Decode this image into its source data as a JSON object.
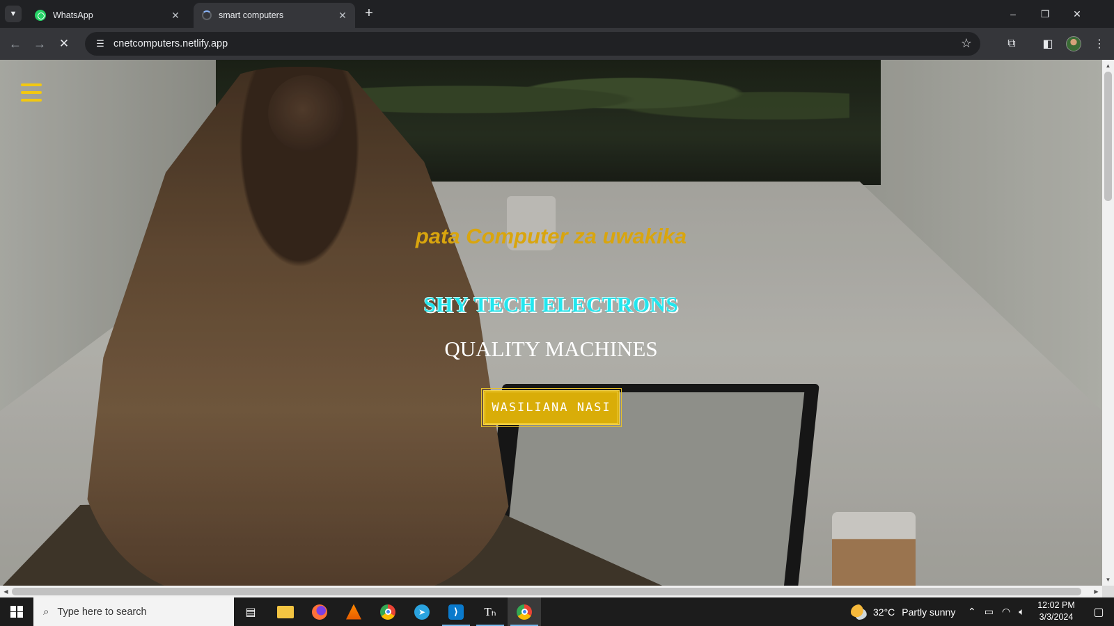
{
  "browser": {
    "tab_list_icon": "chevron-down-icon",
    "tabs": [
      {
        "title": "WhatsApp",
        "icon": "whatsapp-icon",
        "active": false
      },
      {
        "title": "smart computers",
        "icon": "loading-spinner-icon",
        "active": true
      }
    ],
    "new_tab_icon": "plus-icon",
    "window_controls": {
      "minimize": "–",
      "restore": "❐",
      "close": "✕"
    },
    "address_bar": {
      "url": "cnetcomputers.netlify.app"
    }
  },
  "page": {
    "menu_icon": "hamburger-menu-icon",
    "menu_color": "#f2c811",
    "tagline": "pata Computer za uwakika",
    "brand": "SHY TECH ELECTRONS",
    "subtitle": "QUALITY MACHINES",
    "cta_label": "WASILIANA NASI",
    "accent_color": "#d9ad08",
    "brand_color": "#22e6ee"
  },
  "taskbar": {
    "search_placeholder": "Type here to search",
    "apps": [
      {
        "name": "task-view"
      },
      {
        "name": "file-explorer"
      },
      {
        "name": "firefox"
      },
      {
        "name": "vlc"
      },
      {
        "name": "chrome"
      },
      {
        "name": "telegram"
      },
      {
        "name": "vscode"
      },
      {
        "name": "typora"
      },
      {
        "name": "chrome-active"
      }
    ],
    "weather": {
      "temp": "32°C",
      "condition": "Partly sunny"
    },
    "clock": {
      "time": "12:02 PM",
      "date": "3/3/2024"
    }
  }
}
